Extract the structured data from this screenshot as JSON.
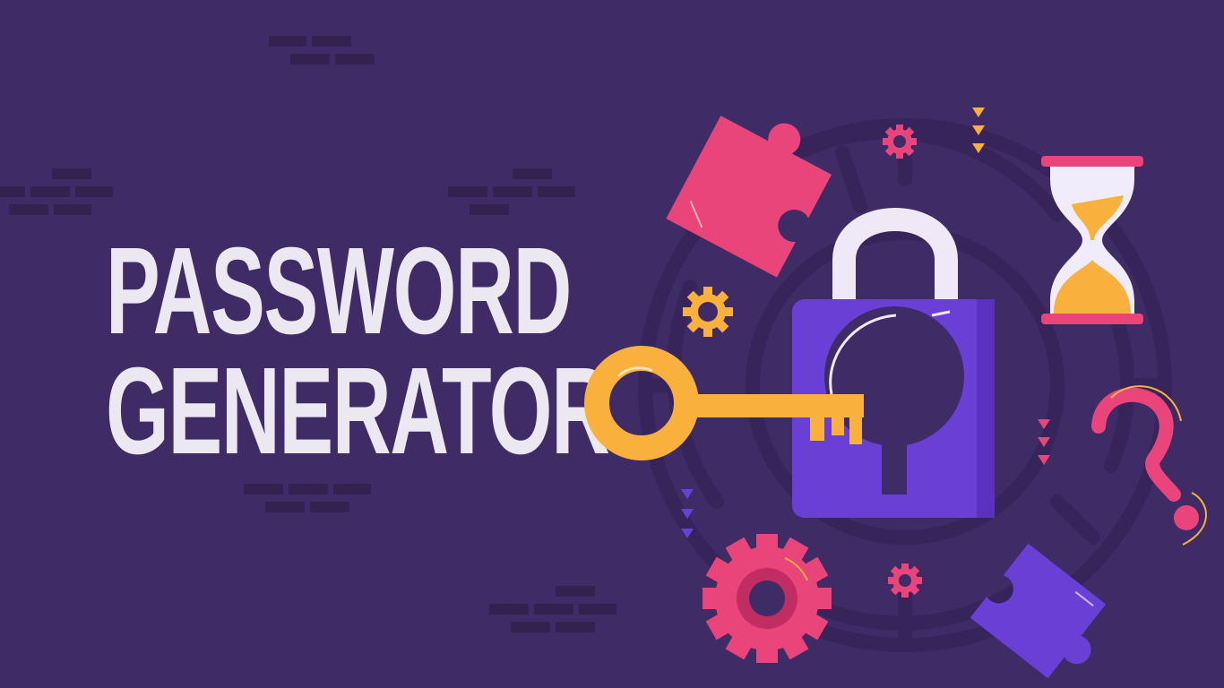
{
  "banner": {
    "title_line1": "PASSWORD",
    "title_line2": "GENERATOR"
  },
  "colors": {
    "background": "#3f2b66",
    "title_text": "#ece8f2",
    "lock_body": "#6a3fd6",
    "key": "#f9b03c",
    "puzzle_pink": "#e9457a",
    "puzzle_purple": "#6a3fd6",
    "gear_pink": "#e9457a",
    "hourglass_sand": "#f9b03c"
  },
  "icons": [
    "padlock-icon",
    "key-icon",
    "puzzle-piece-icon",
    "hourglass-icon",
    "question-mark-icon",
    "gear-icon",
    "maze-icon",
    "arrow-down-icon"
  ]
}
